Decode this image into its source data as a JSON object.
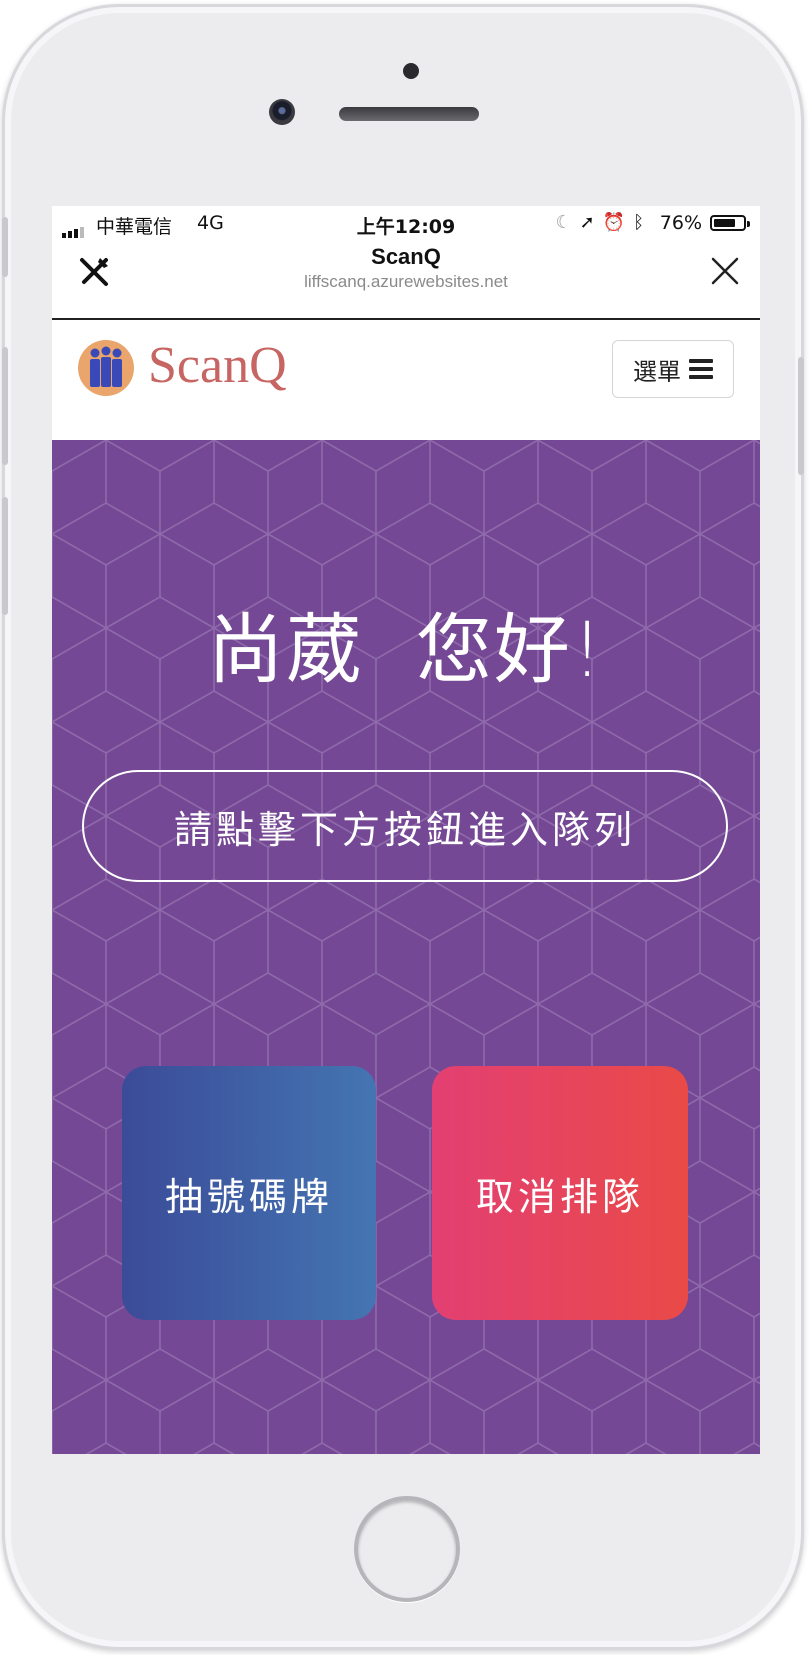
{
  "status_bar": {
    "carrier": "中華電信",
    "network": "4G",
    "time": "上午12:09",
    "battery": "76%",
    "battery_level": 0.76
  },
  "nav": {
    "title": "ScanQ",
    "url": "liffscanq.azurewebsites.net"
  },
  "header": {
    "brand": "ScanQ",
    "menu_label": "選單"
  },
  "main": {
    "greeting": "尚葳  您好!",
    "instruction": "請點擊下方按鈕進入隊列",
    "take_number_label": "抽號碼牌",
    "cancel_queue_label": "取消排隊"
  },
  "colors": {
    "hero_bg": "#744894",
    "brand": "#c66562",
    "take_button": "#3b4b98",
    "cancel_button": "#e94a47"
  },
  "icons": [
    "signal-icon",
    "moon-icon",
    "location-icon",
    "alarm-icon",
    "bluetooth-icon",
    "battery-icon",
    "tools-icon",
    "close-icon",
    "logo-icon",
    "hamburger-icon"
  ]
}
